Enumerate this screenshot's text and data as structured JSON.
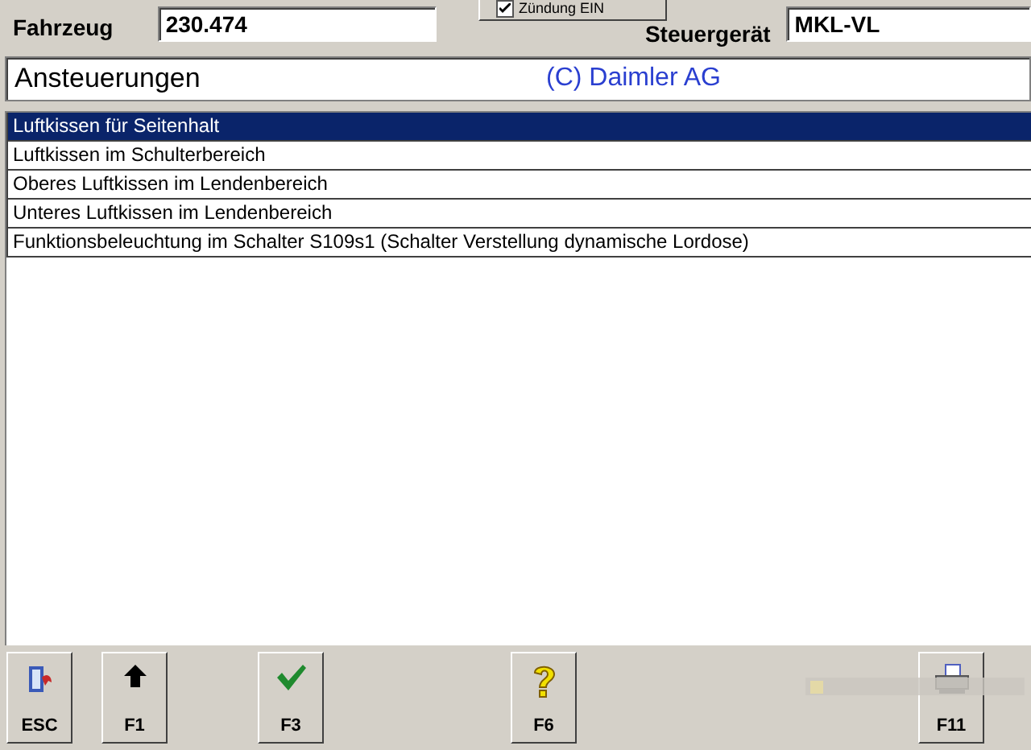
{
  "header": {
    "vehicle_label": "Fahrzeug",
    "vehicle_value": "230.474",
    "unit_label": "Steuergerät",
    "unit_value": "MKL-VL"
  },
  "popup": {
    "checkbox": {
      "label": "Zündung EIN",
      "checked": true
    }
  },
  "title_bar": {
    "title": "Ansteuerungen",
    "copyright": "(C) Daimler AG"
  },
  "list": [
    {
      "label": "Luftkissen für Seitenhalt",
      "selected": true
    },
    {
      "label": "Luftkissen im Schulterbereich",
      "selected": false
    },
    {
      "label": "Oberes Luftkissen im Lendenbereich",
      "selected": false
    },
    {
      "label": "Unteres Luftkissen im Lendenbereich",
      "selected": false
    },
    {
      "label": "Funktionsbeleuchtung im Schalter S109s1 (Schalter Verstellung dynamische Lordose)",
      "selected": false
    }
  ],
  "toolbar": [
    {
      "kind": "exit",
      "label": "ESC"
    },
    {
      "kind": "up",
      "label": "F1"
    },
    {
      "kind": "ok",
      "label": "F3"
    },
    {
      "kind": "help",
      "label": "F6"
    },
    {
      "kind": "print",
      "label": "F11"
    }
  ]
}
